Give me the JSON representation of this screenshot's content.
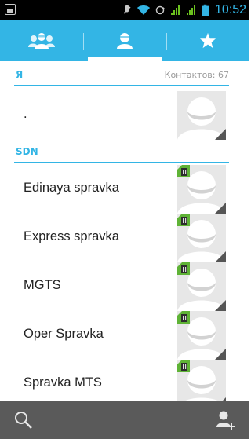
{
  "status_bar": {
    "time": "10:52",
    "icons": [
      "image-notification-icon",
      "mute-icon",
      "wifi-icon",
      "sync-icon",
      "signal-sim1-icon",
      "signal-sim2-icon",
      "battery-icon"
    ]
  },
  "tabs": [
    {
      "name": "groups",
      "icon": "groups-icon",
      "active": false
    },
    {
      "name": "contacts",
      "icon": "person-icon",
      "active": true
    },
    {
      "name": "favorites",
      "icon": "star-icon",
      "active": false
    }
  ],
  "sections": {
    "me": {
      "title": "Я",
      "count": "Контактов: 67"
    },
    "sdn": {
      "title": "SDN"
    }
  },
  "contacts": {
    "me": {
      "name": "."
    },
    "sdn": [
      {
        "name": "Edinaya spravka"
      },
      {
        "name": "Express spravka"
      },
      {
        "name": "MGTS"
      },
      {
        "name": "Oper Spravka"
      },
      {
        "name": "Spravka MTS"
      }
    ]
  },
  "bottom_bar": {
    "left_icon": "search-icon",
    "right_icon": "add-contact-icon"
  },
  "colors": {
    "accent": "#33b5e5",
    "bottom_bar": "#5a5a5a",
    "avatar_bg": "#e7e7e7",
    "sim_green": "#5fb336"
  }
}
